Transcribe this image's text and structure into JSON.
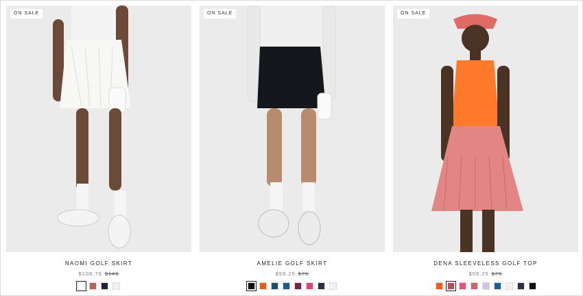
{
  "products": [
    {
      "badge": "ON SALE",
      "name": "NAOMI GOLF SKIRT",
      "sale_price": "$108.75",
      "original_price": "$145",
      "image": "model-white-pleated-skirt-photo",
      "swatches": [
        {
          "color": "#ffffff",
          "selected": true
        },
        {
          "color": "#b46458",
          "selected": false
        },
        {
          "color": "#1f2433",
          "selected": false
        },
        {
          "color": "#f1f1ef",
          "selected": false
        }
      ]
    },
    {
      "badge": "ON SALE",
      "name": "AMELIE GOLF SKIRT",
      "sale_price": "$56.25",
      "original_price": "$75",
      "image": "model-black-skirt-photo",
      "swatches": [
        {
          "color": "#111111",
          "selected": true
        },
        {
          "color": "#e85a1f",
          "selected": false
        },
        {
          "color": "#1d4f63",
          "selected": false
        },
        {
          "color": "#1c5a96",
          "selected": false
        },
        {
          "color": "#7a2242",
          "selected": false
        },
        {
          "color": "#e0457a",
          "selected": false
        },
        {
          "color": "#2a3040",
          "selected": false
        },
        {
          "color": "#f2f2f0",
          "selected": false
        }
      ]
    },
    {
      "badge": "ON SALE",
      "name": "DENA SLEEVELESS GOLF TOP",
      "sale_price": "$56.25",
      "original_price": "$75",
      "image": "model-orange-sleeveless-top-photo",
      "swatches": [
        {
          "color": "#f05a1a",
          "selected": false
        },
        {
          "color": "#b84c50",
          "selected": true
        },
        {
          "color": "#e9507e",
          "selected": false
        },
        {
          "color": "#c76a6a",
          "selected": false
        },
        {
          "color": "#cfc6e6",
          "selected": false
        },
        {
          "color": "#1b5e9c",
          "selected": false
        },
        {
          "color": "#f3f2ee",
          "selected": false
        },
        {
          "color": "#2b3140",
          "selected": false
        },
        {
          "color": "#0d0d0d",
          "selected": false
        }
      ]
    }
  ]
}
